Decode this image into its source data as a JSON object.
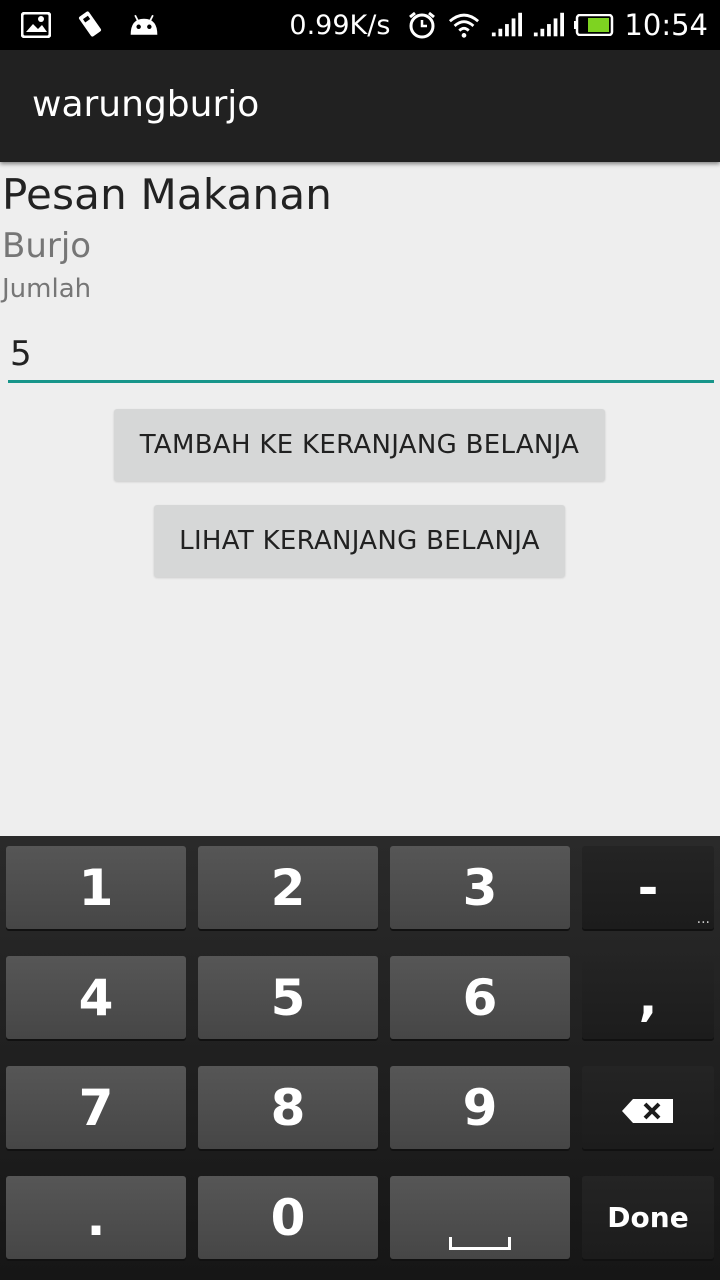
{
  "status_bar": {
    "icons_left": [
      "gallery-icon",
      "sim-tools-icon",
      "android-icon"
    ],
    "net_speed": "0.99K/s",
    "icons_right": [
      "alarm-icon",
      "wifi-icon",
      "signal-1-icon",
      "signal-2-icon",
      "battery-icon"
    ],
    "time": "10:54"
  },
  "action_bar": {
    "title": "warungburjo"
  },
  "main": {
    "page_title": "Pesan Makanan",
    "item_name": "Burjo",
    "quantity_label": "Jumlah",
    "quantity_value": "5",
    "add_to_cart_label": "TAMBAH KE KERANJANG BELANJA",
    "view_cart_label": "LIHAT KERANJANG BELANJA"
  },
  "keyboard": {
    "keys": {
      "k1": "1",
      "k2": "2",
      "k3": "3",
      "minus": "-",
      "k4": "4",
      "k5": "5",
      "k6": "6",
      "comma": ",",
      "k7": "7",
      "k8": "8",
      "k9": "9",
      "period": ".",
      "k0": "0",
      "done": "Done"
    },
    "minus_extra": "...",
    "backspace_icon": "backspace-icon",
    "space_icon": "space-icon"
  },
  "colors": {
    "accent": "#17958a",
    "action_bar": "#212121",
    "background": "#eeeeee",
    "button": "#d6d7d7"
  }
}
